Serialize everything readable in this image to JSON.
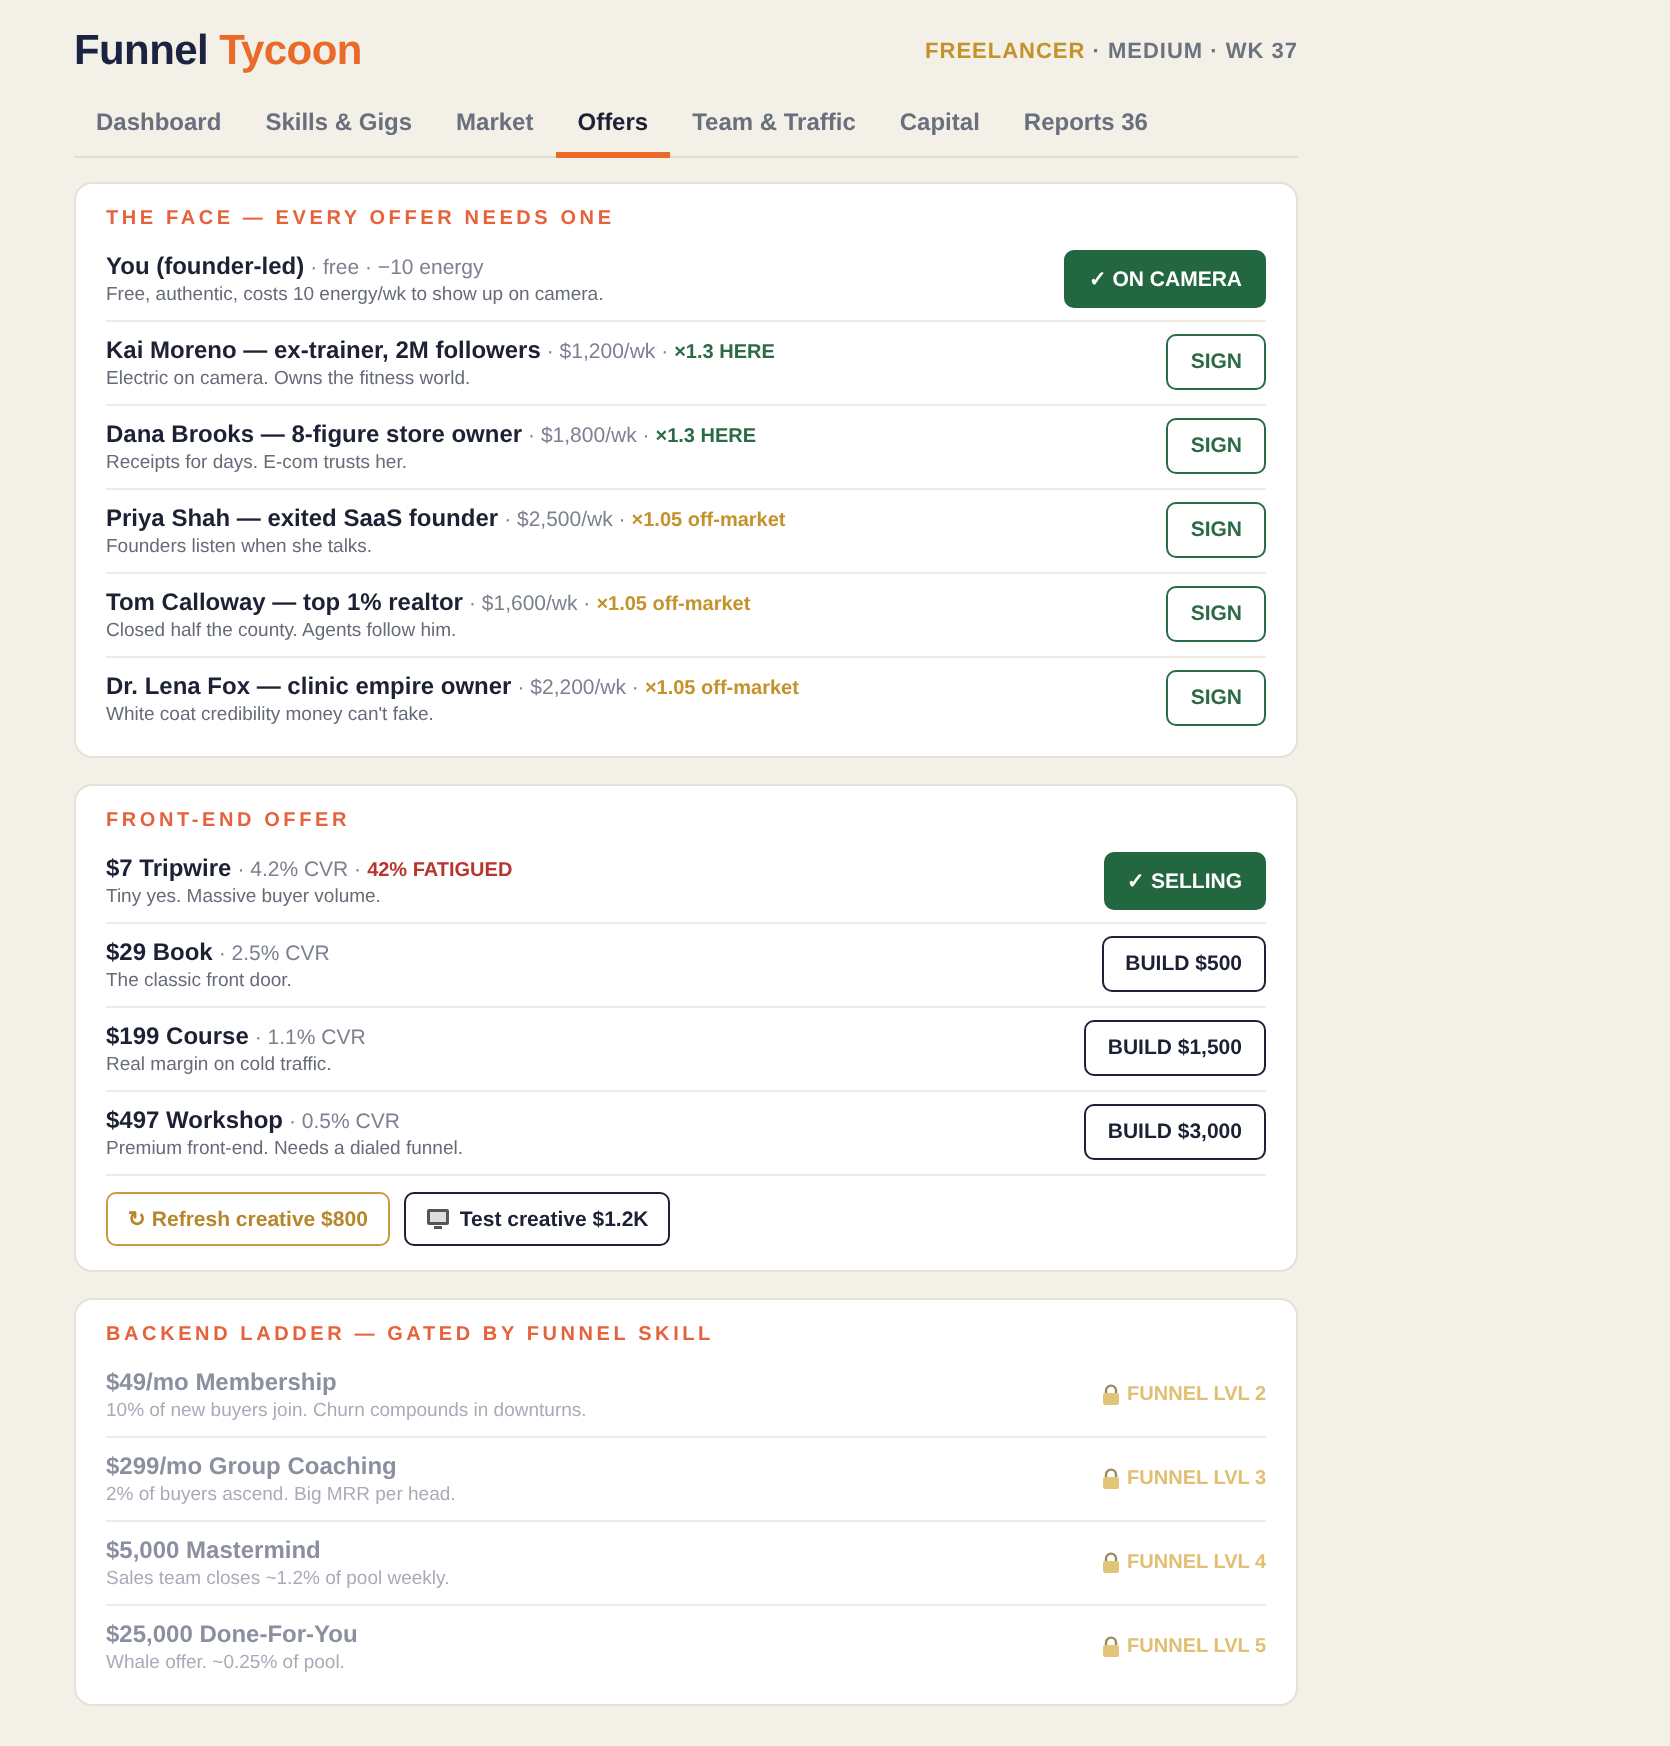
{
  "header": {
    "logo": {
      "first": "Funnel",
      "second": "Tycoon"
    },
    "status": {
      "tier": "FREELANCER",
      "rest": "· MEDIUM · WK 37"
    }
  },
  "tabs": [
    {
      "label": "Dashboard",
      "selected": false
    },
    {
      "label": "Skills & Gigs",
      "selected": false
    },
    {
      "label": "Market",
      "selected": false
    },
    {
      "label": "Offers",
      "selected": true
    },
    {
      "label": "Team & Traffic",
      "selected": false
    },
    {
      "label": "Capital",
      "selected": false
    },
    {
      "label": "Reports 36",
      "selected": false
    }
  ],
  "face_section": {
    "title": "THE FACE — EVERY OFFER NEEDS ONE",
    "rows": [
      {
        "name": "You (founder-led)",
        "meta": "· free · −10 energy",
        "desc": "Free, authentic, costs 10 energy/wk to show up on camera.",
        "action": {
          "label": "✓ ON CAMERA",
          "active": true
        }
      },
      {
        "name": "Kai Moreno — ex-trainer, 2M followers",
        "meta": "· $1,200/wk ·",
        "bonus": {
          "text": "×1.3 HERE",
          "kind": "local"
        },
        "desc": "Electric on camera. Owns the fitness world.",
        "action": {
          "label": "SIGN",
          "active": false
        }
      },
      {
        "name": "Dana Brooks — 8-figure store owner",
        "meta": "· $1,800/wk ·",
        "bonus": {
          "text": "×1.3 HERE",
          "kind": "local"
        },
        "desc": "Receipts for days. E-com trusts her.",
        "action": {
          "label": "SIGN",
          "active": false
        }
      },
      {
        "name": "Priya Shah — exited SaaS founder",
        "meta": "· $2,500/wk ·",
        "bonus": {
          "text": "×1.05 off-market",
          "kind": "off"
        },
        "desc": "Founders listen when she talks.",
        "action": {
          "label": "SIGN",
          "active": false
        }
      },
      {
        "name": "Tom Calloway — top 1% realtor",
        "meta": "· $1,600/wk ·",
        "bonus": {
          "text": "×1.05 off-market",
          "kind": "off"
        },
        "desc": "Closed half the county. Agents follow him.",
        "action": {
          "label": "SIGN",
          "active": false
        }
      },
      {
        "name": "Dr. Lena Fox — clinic empire owner",
        "meta": "· $2,200/wk ·",
        "bonus": {
          "text": "×1.05 off-market",
          "kind": "off"
        },
        "desc": "White coat credibility money can't fake.",
        "action": {
          "label": "SIGN",
          "active": false
        }
      }
    ]
  },
  "front_section": {
    "title": "FRONT-END OFFER",
    "rows": [
      {
        "name": "$7 Tripwire",
        "meta": "· 4.2% CVR ·",
        "warning": "42% FATIGUED",
        "desc": "Tiny yes. Massive buyer volume.",
        "action": {
          "label": "✓ SELLING",
          "active": true
        }
      },
      {
        "name": "$29 Book",
        "meta": "· 2.5% CVR",
        "desc": "The classic front door.",
        "action": {
          "label": "BUILD $500",
          "active": false
        }
      },
      {
        "name": "$199 Course",
        "meta": "· 1.1% CVR",
        "desc": "Real margin on cold traffic.",
        "action": {
          "label": "BUILD $1,500",
          "active": false
        }
      },
      {
        "name": "$497 Workshop",
        "meta": "· 0.5% CVR",
        "desc": "Premium front-end. Needs a dialed funnel.",
        "action": {
          "label": "BUILD $3,000",
          "active": false
        }
      }
    ],
    "tools": [
      {
        "kind": "refresh",
        "label": "↻ Refresh creative $800"
      },
      {
        "kind": "test",
        "label": "Test creative $1.2K"
      }
    ]
  },
  "backend_section": {
    "title": "BACKEND LADDER — GATED BY FUNNEL SKILL",
    "rows": [
      {
        "name": "$49/mo Membership",
        "desc": "10% of new buyers join. Churn compounds in downturns.",
        "locked": true,
        "lock_label": "FUNNEL LVL 2"
      },
      {
        "name": "$299/mo Group Coaching",
        "desc": "2% of buyers ascend. Big MRR per head.",
        "locked": true,
        "lock_label": "FUNNEL LVL 3"
      },
      {
        "name": "$5,000 Mastermind",
        "desc": "Sales team closes ~1.2% of pool weekly.",
        "locked": true,
        "lock_label": "FUNNEL LVL 4"
      },
      {
        "name": "$25,000 Done-For-You",
        "desc": "Whale offer. ~0.25% of pool.",
        "locked": true,
        "lock_label": "FUNNEL LVL 5"
      }
    ]
  }
}
